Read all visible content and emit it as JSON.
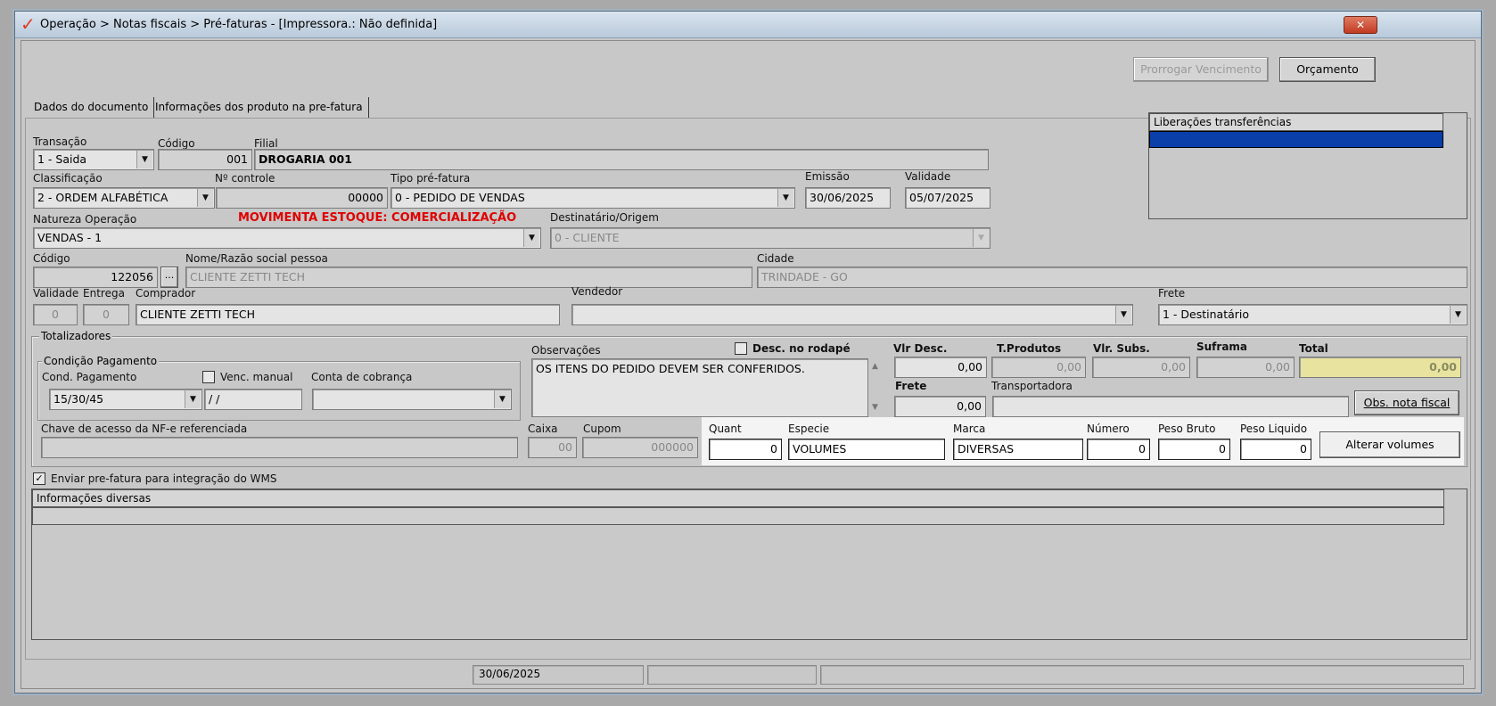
{
  "window": {
    "title": "Operação > Notas fiscais > Pré-faturas - [Impressora.: Não definida]",
    "close_glyph": "✕"
  },
  "toolbar": {
    "prorrogar_label": "Prorrogar Vencimento",
    "orcamento_label": "Orçamento"
  },
  "tabs": [
    {
      "label": "Dados do documento"
    },
    {
      "label": "Informações dos produto na pre-fatura"
    }
  ],
  "doc": {
    "transacao_label": "Transação",
    "transacao_value": "1 - Saida",
    "codigo_label": "Código",
    "codigo_value": "001",
    "filial_label": "Filial",
    "filial_value": "DROGARIA 001",
    "classificacao_label": "Classificação",
    "classificacao_value": "2 - ORDEM ALFABÉTICA",
    "controle_label": "Nº controle",
    "controle_value": "00000",
    "tipo_label": "Tipo pré-fatura",
    "tipo_value": "0  - PEDIDO DE VENDAS",
    "emissao_label": "Emissão",
    "emissao_value": "30/06/2025",
    "validade_label": "Validade",
    "validade_value": "05/07/2025",
    "natureza_label": "Natureza  Operação",
    "natureza_value": "VENDAS - 1",
    "movimenta_label": "MOVIMENTA ESTOQUE: COMERCIALIZAÇÃO",
    "destinatario_label": "Destinatário/Origem",
    "destinatario_value": "0 - CLIENTE",
    "cod_pessoa_label": "Código",
    "cod_pessoa_value": "122056",
    "ellipsis": "...",
    "nome_label": "Nome/Razão social pessoa",
    "nome_value": "CLIENTE ZETTI TECH",
    "cidade_label": "Cidade",
    "cidade_value": "TRINDADE - GO",
    "validade2_label": "Validade",
    "validade2_value": "0",
    "entrega_label": "Entrega",
    "entrega_value": "0",
    "comprador_label": "Comprador",
    "comprador_value": "CLIENTE ZETTI TECH",
    "vendedor_label": "Vendedor",
    "vendedor_value": "",
    "frete_label": "Frete",
    "frete_value": "1 - Destinatário"
  },
  "liberacoes": {
    "header": "Liberações transferências"
  },
  "totalizadores": {
    "title": "Totalizadores",
    "cond_group_title": "Condição Pagamento",
    "cond_label": "Cond. Pagamento",
    "cond_value": "15/30/45",
    "venc_label": "Venc. manual",
    "venc_value": "/  /",
    "conta_label": "Conta de cobrança",
    "conta_value": "",
    "obs_label": "Observações",
    "obs_value": "OS ITENS DO PEDIDO DEVEM SER CONFERIDOS.",
    "desc_rodape_label": "Desc. no rodapé",
    "vlr_desc_label": "Vlr Desc.",
    "vlr_desc_value": "0,00",
    "tprod_label": "T.Produtos",
    "tprod_value": "0,00",
    "vlr_subs_label": "Vlr. Subs.",
    "vlr_subs_value": "0,00",
    "suframa_label": "Suframa",
    "suframa_value": "0,00",
    "total_label": "Total",
    "total_value": "0,00",
    "frete_label": "Frete",
    "frete_value": "0,00",
    "transportadora_label": "Transportadora",
    "transportadora_value": "",
    "obs_nota_label": "Obs. nota fiscal",
    "chave_label": "Chave de acesso da NF-e referenciada",
    "chave_value": "",
    "caixa_label": "Caixa",
    "caixa_value": "00",
    "cupom_label": "Cupom",
    "cupom_value": "000000"
  },
  "volumes": {
    "quant_label": "Quant",
    "quant_value": "0",
    "especie_label": "Especie",
    "especie_value": "VOLUMES",
    "marca_label": "Marca",
    "marca_value": "DIVERSAS",
    "numero_label": "Número",
    "numero_value": "0",
    "peso_bruto_label": "Peso Bruto",
    "peso_bruto_value": "0",
    "peso_liquido_label": "Peso Liquido",
    "peso_liquido_value": "0",
    "alterar_label": "Alterar volumes"
  },
  "wms": {
    "label": "Enviar pre-fatura para integração do WMS",
    "checked_glyph": "✓"
  },
  "info": {
    "header": "Informações diversas"
  },
  "statusbar": {
    "date": "30/06/2025",
    "cell2": "",
    "cell3": ""
  },
  "colors": {
    "selection_blue": "#0a3ea8",
    "total_bg": "#e8e4a0",
    "alert_red": "#e00000"
  }
}
